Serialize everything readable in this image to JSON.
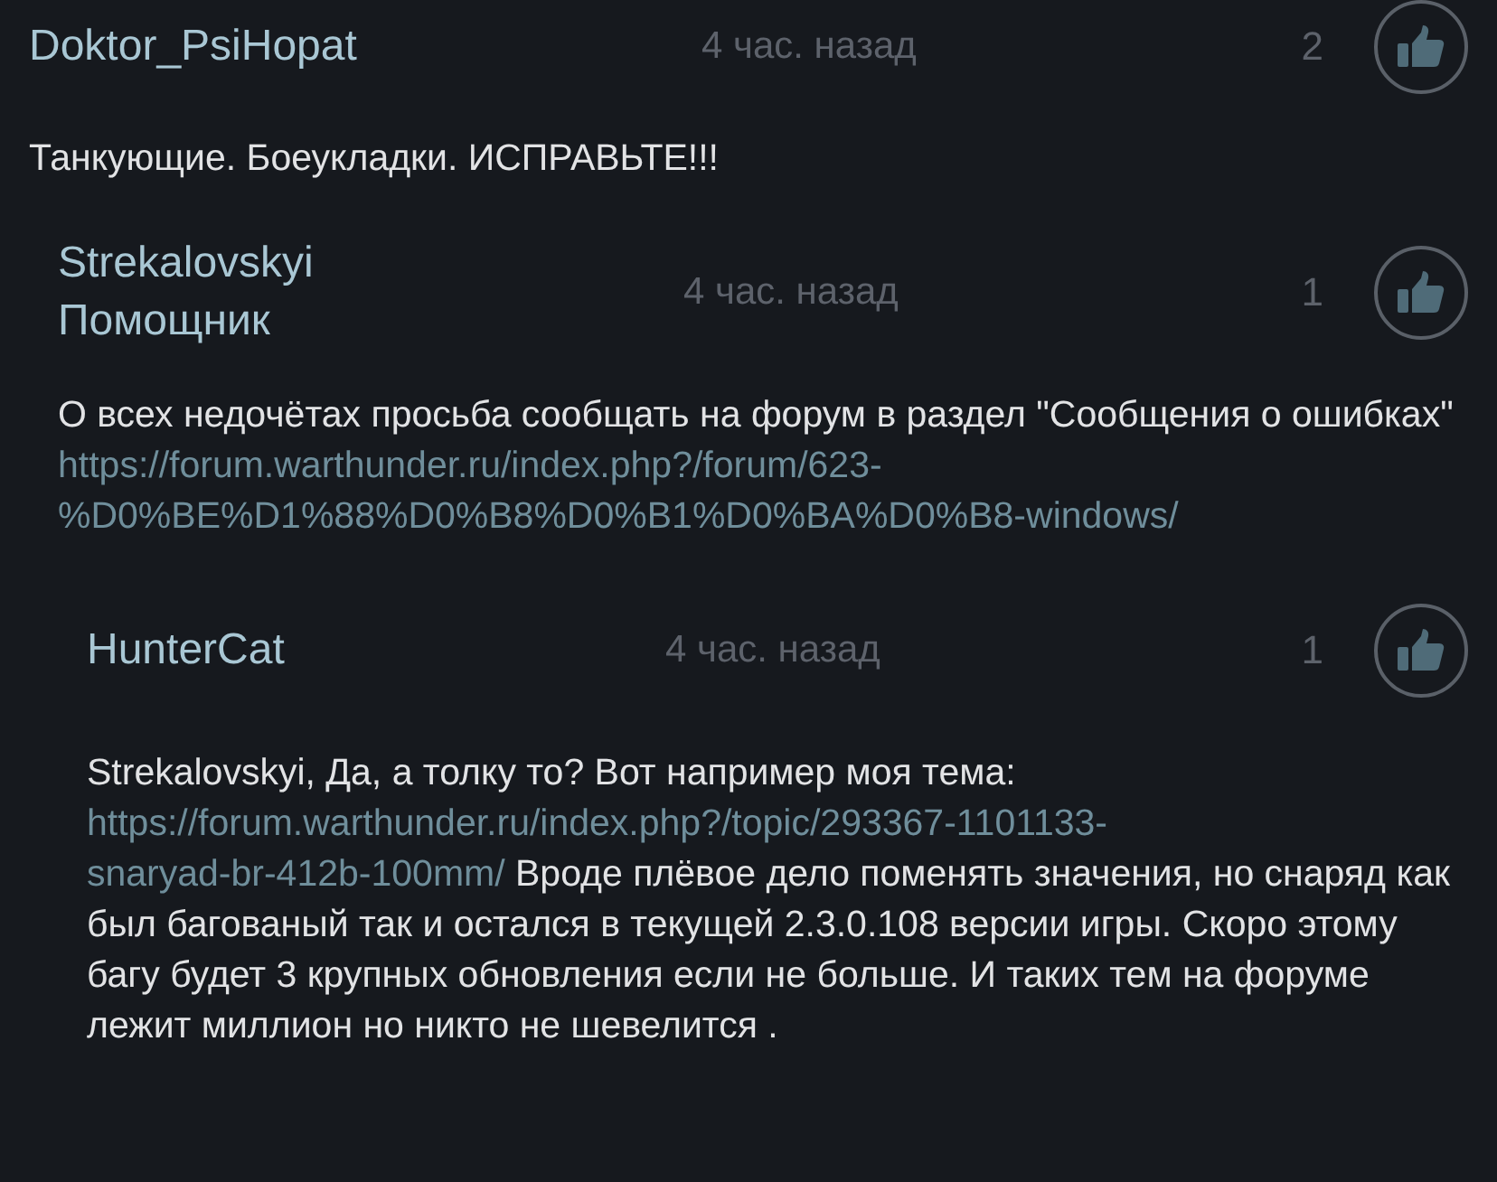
{
  "comments": [
    {
      "author": "Doktor_PsiHopat",
      "time": "4 час. назад",
      "likes": "2",
      "body": [
        {
          "kind": "text",
          "text": "Танкующие. Боеукладки. ИСПРАВЬТЕ!!!"
        }
      ],
      "children": [
        {
          "author": "Strekalovskyi",
          "role": "Помощник",
          "time": "4 час. назад",
          "likes": "1",
          "body": [
            {
              "kind": "text",
              "text": "О всех недочётах просьба сообщать на форум в раздел \"Сообщения о ошибках\" "
            },
            {
              "kind": "link",
              "text": "https://forum.warthunder.ru/index.php?/forum/623-"
            },
            {
              "kind": "break"
            },
            {
              "kind": "link",
              "text": "%D0%BE%D1%88%D0%B8%D0%B1%D0%BA%D0%B8-windows/"
            }
          ],
          "children": [
            {
              "author": "HunterCat",
              "time": "4 час. назад",
              "likes": "1",
              "body": [
                {
                  "kind": "text",
                  "text": "Strekalovskyi, Да, а толку то? Вот например моя тема:"
                },
                {
                  "kind": "break"
                },
                {
                  "kind": "link",
                  "text": "https://forum.warthunder.ru/index.php?/topic/293367-1101133-"
                },
                {
                  "kind": "break"
                },
                {
                  "kind": "link",
                  "text": "snaryad-br-412b-100mm/"
                },
                {
                  "kind": "text",
                  "text": " Вроде плёвое дело поменять значения, но снаряд как был багованый так и остался в текущей 2.3.0.108 версии игры. Скоро этому багу будет 3 крупных обновления если не больше. И таких тем на форуме лежит миллион но никто не шевелится ."
                }
              ]
            }
          ]
        }
      ]
    }
  ]
}
